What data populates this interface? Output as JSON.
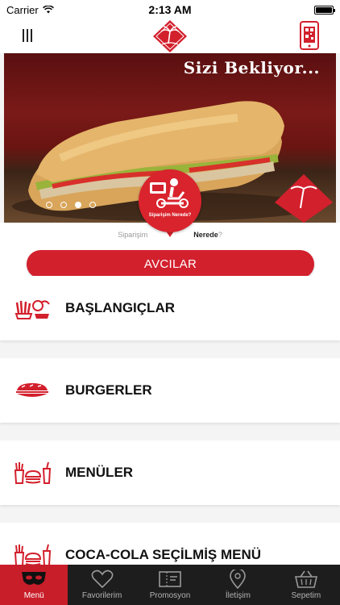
{
  "status_bar": {
    "carrier": "Carrier",
    "time": "2:13 AM"
  },
  "navbar": {
    "logo_icon": "palm-logo-icon",
    "menu_icon": "hamburger-icon",
    "qr_icon": "phone-qr-icon"
  },
  "hero": {
    "headline": "Sizi Bekliyor...",
    "slides": 4,
    "active_slide": 3
  },
  "order_tracker": {
    "bubble_label": "Siparişim Nerede?",
    "caption_prefix": "Siparişim",
    "caption_bold": "Nerede",
    "caption_suffix": "?"
  },
  "location_button": {
    "label": "AVCILAR"
  },
  "categories": [
    {
      "label": "BAŞLANGIÇLAR",
      "icon": "starters-icon"
    },
    {
      "label": "BURGERLER",
      "icon": "sandwich-icon"
    },
    {
      "label": "MENÜLER",
      "icon": "meal-icon"
    },
    {
      "label": "COCA-COLA SEÇİLMİŞ MENÜ",
      "icon": "combo-meal-icon"
    }
  ],
  "tabbar": [
    {
      "label": "Menü",
      "icon": "mask-icon",
      "active": true
    },
    {
      "label": "Favorilerim",
      "icon": "heart-icon",
      "active": false
    },
    {
      "label": "Promosyon",
      "icon": "coupon-icon",
      "active": false
    },
    {
      "label": "İletişim",
      "icon": "location-pin-icon",
      "active": false
    },
    {
      "label": "Sepetim",
      "icon": "basket-icon",
      "active": false
    }
  ],
  "colors": {
    "brand_red": "#d3202d",
    "tabbar_bg": "#1d1d1d"
  }
}
